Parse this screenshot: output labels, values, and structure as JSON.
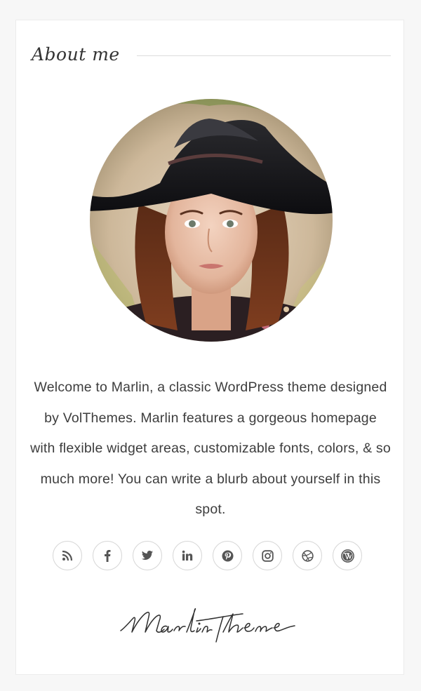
{
  "widget": {
    "title": "About me",
    "avatar_alt": "Portrait of a woman wearing a black wide-brimmed hat",
    "about_text": "Welcome to Marlin, a classic WordPress theme designed by VolThemes. Marlin features a gorgeous homepage with flexible widget areas, customizable fonts, colors, & so much more! You can write a blurb about yourself in this spot.",
    "signature_text": "Marlin theme"
  },
  "social_links": [
    {
      "name": "rss",
      "icon": "rss-icon"
    },
    {
      "name": "facebook",
      "icon": "facebook-icon"
    },
    {
      "name": "twitter",
      "icon": "twitter-icon"
    },
    {
      "name": "linkedin",
      "icon": "linkedin-icon"
    },
    {
      "name": "pinterest",
      "icon": "pinterest-icon"
    },
    {
      "name": "instagram",
      "icon": "instagram-icon"
    },
    {
      "name": "dribbble",
      "icon": "dribbble-icon"
    },
    {
      "name": "wordpress",
      "icon": "wordpress-icon"
    }
  ],
  "colors": {
    "page_background": "#f7f7f7",
    "card_background": "#ffffff",
    "text": "#3d3d3d",
    "icon": "#555555",
    "icon_border": "#d6d6d6",
    "rule": "#dcdcdc"
  }
}
